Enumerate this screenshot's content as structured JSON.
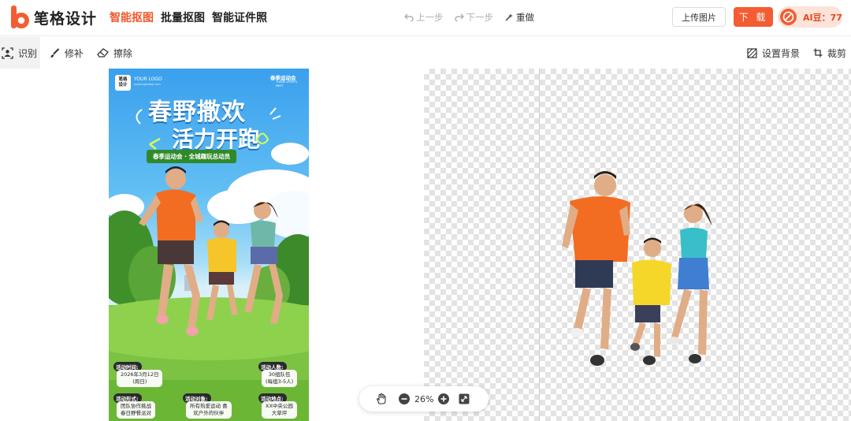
{
  "brand": {
    "name": "笔格设计",
    "accent": "#f35d33"
  },
  "nav": [
    {
      "label": "智能抠图",
      "active": true
    },
    {
      "label": "批量抠图",
      "active": false
    },
    {
      "label": "智能证件照",
      "active": false
    }
  ],
  "history": {
    "undo": "上一步",
    "redo": "下一步",
    "reset": "重做"
  },
  "header_buttons": {
    "upload": "上传图片",
    "download": "下 载",
    "ai_credits": "AI豆：77"
  },
  "tools": {
    "recognize": "识别",
    "repair": "修补",
    "erase": "擦除",
    "set_background": "设置背景",
    "crop": "裁剪"
  },
  "poster": {
    "logo_box": "笔格\n设计",
    "your_logo": "YOUR LOGO",
    "your_logo_sub": "www.bigesheji.com",
    "event_tag": "春季运动会",
    "event_tag_sub": "THEME SPORTS\nMEET",
    "headline_1": "春野撒欢",
    "headline_2": "活力开跑",
    "subtitle": "春季运动会 · 全城趣玩总动员",
    "info": [
      {
        "label": "活动时间:",
        "value": "2026年3月12日\n(周日)"
      },
      {
        "label": "活动人数:",
        "value": "30组队伍\n(每组3-5人)"
      },
      {
        "label": "活动形式:",
        "value": "团队协作挑战\n春日野餐派对"
      },
      {
        "label": "活动对象:",
        "value": "所有热爱运动 喜\n欢户外的伙伴"
      },
      {
        "label": "活动地点:",
        "value": "XX中央公园\n大草坪"
      }
    ]
  },
  "zoom": {
    "value": "26%"
  }
}
